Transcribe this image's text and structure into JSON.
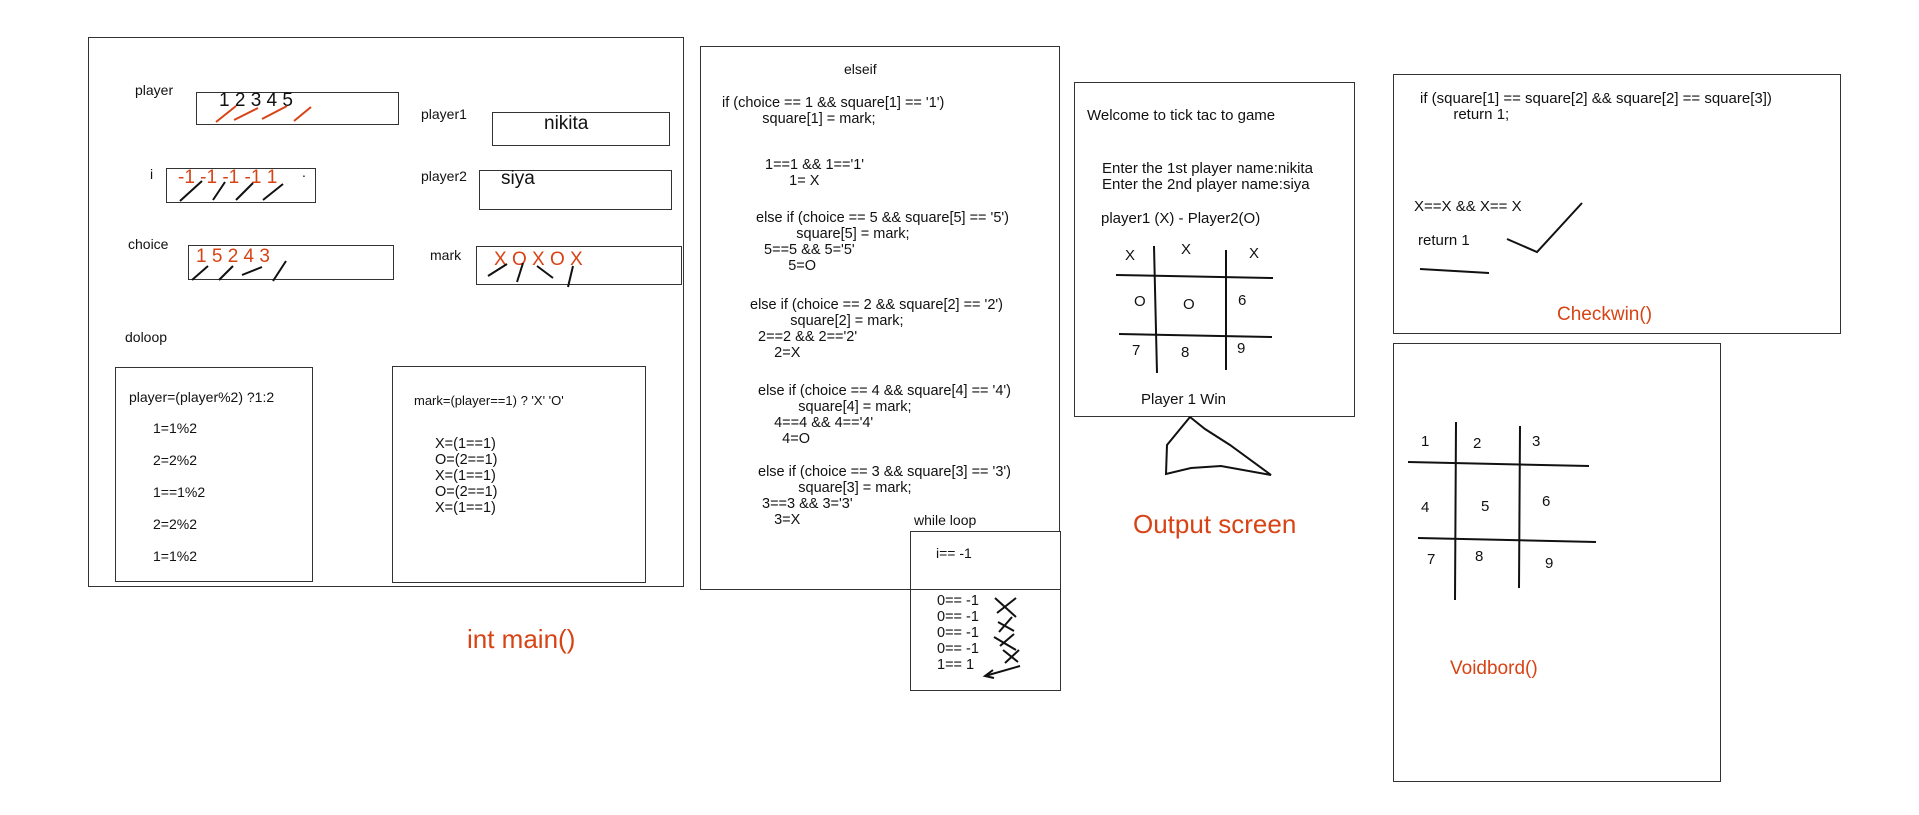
{
  "colors": {
    "accent": "#d84315",
    "ink": "#111111",
    "border": "#333333"
  },
  "main": {
    "title": "int main()",
    "player": {
      "label": "player",
      "values": "1  2  3  4  5"
    },
    "player1": {
      "label": "player1",
      "value": "nikita"
    },
    "player2": {
      "label": "player2",
      "value": "siya"
    },
    "i": {
      "label": "i",
      "values": "-1 -1 -1 -1 1",
      "dot": "."
    },
    "choice": {
      "label": "choice",
      "values": "1  5  2  4  3"
    },
    "mark": {
      "label": "mark",
      "values": "X O X O X"
    },
    "doloop": "doloop",
    "player_box": {
      "formula": "player=(player%2)  ?1:2",
      "lines": [
        "1=1%2",
        "2=2%2",
        "1==1%2",
        "2=2%2",
        "1=1%2"
      ]
    },
    "mark_box": {
      "formula": "mark=(player==1) ? 'X'  'O'",
      "lines": "X=(1==1)\nO=(2==1)\nX=(1==1)\nO=(2==1)\nX=(1==1)"
    }
  },
  "elseif": {
    "title": "elseif",
    "blocks": [
      "if (choice == 1 && square[1] == '1')\n          square[1] = mark;",
      "1==1 && 1=='1'\n      1= X",
      "else if (choice == 5 && square[5] == '5')\n          square[5] = mark;\n  5==5 && 5='5'\n        5=O",
      "else if (choice == 2 && square[2] == '2')\n          square[2] = mark;\n  2==2 && 2=='2'\n      2=X",
      "else if (choice == 4 && square[4] == '4')\n          square[4] = mark;\n    4==4 && 4=='4'\n      4=O",
      "else if (choice == 3 && square[3] == '3')\n          square[3] = mark;\n 3==3 && 3='3'\n    3=X"
    ]
  },
  "while_loop": {
    "label": "while loop",
    "condition": "i== -1",
    "lines": "0== -1\n0== -1\n0== -1\n0== -1\n1== 1"
  },
  "output": {
    "caption": "Output screen",
    "welcome": "Welcome to tick tac to game",
    "prompts": "Enter the 1st player name:nikita\nEnter the 2nd player name:siya",
    "header": "player1 (X) - Player2(O)",
    "grid": [
      "X",
      "X",
      "X",
      "O",
      "O",
      "6",
      "7",
      "8",
      "9"
    ],
    "result": "Player 1 Win"
  },
  "checkwin": {
    "caption": "Checkwin()",
    "code": "if (square[1] == square[2] && square[2] == square[3])\n        return 1;",
    "compare": "X==X && X== X",
    "ret": "return 1"
  },
  "board": {
    "caption": "Voidbord()",
    "cells": [
      "1",
      "2",
      "3",
      "4",
      "5",
      "6",
      "7",
      "8",
      "9"
    ]
  }
}
